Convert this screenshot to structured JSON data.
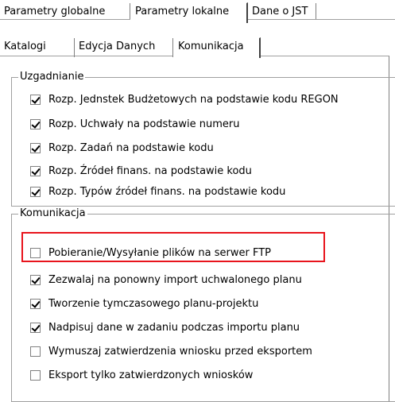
{
  "top_tabs": [
    {
      "label": "Parametry globalne"
    },
    {
      "label": "Parametry lokalne"
    },
    {
      "label": "Dane o JST"
    }
  ],
  "sub_tabs": [
    {
      "label": "Katalogi"
    },
    {
      "label": "Edycja Danych"
    },
    {
      "label": "Komunikacja"
    }
  ],
  "uzgadnianie": {
    "legend": "Uzgadnianie",
    "items": [
      {
        "label": "Rozp.  Jednstek Budżetowych na podstawie kodu REGON",
        "checked": true
      },
      {
        "label": "Rozp.  Uchwały na podstawie numeru",
        "checked": true
      },
      {
        "label": "Rozp.  Zadań na podstawie kodu",
        "checked": true
      },
      {
        "label": "Rozp.  Źródeł finans. na podstawie kodu",
        "checked": true
      },
      {
        "label": "Rozp.  Typów źródeł finans. na podstawie kodu",
        "checked": true
      }
    ]
  },
  "komunikacja": {
    "legend": "Komunikacja",
    "items": [
      {
        "label": "Pobieranie/Wysyłanie plików na serwer FTP",
        "checked": false
      },
      {
        "label": "Zezwalaj na ponowny import uchwalonego planu",
        "checked": true
      },
      {
        "label": "Tworzenie tymczasowego planu-projektu",
        "checked": true
      },
      {
        "label": "Nadpisuj dane w zadaniu podczas importu planu",
        "checked": true
      },
      {
        "label": "Wymuszaj zatwierdzenia wniosku przed eksportem",
        "checked": false
      },
      {
        "label": "Eksport tylko zatwierdzonych wniosków",
        "checked": false
      }
    ]
  },
  "colors": {
    "highlight": "#e8141c"
  }
}
